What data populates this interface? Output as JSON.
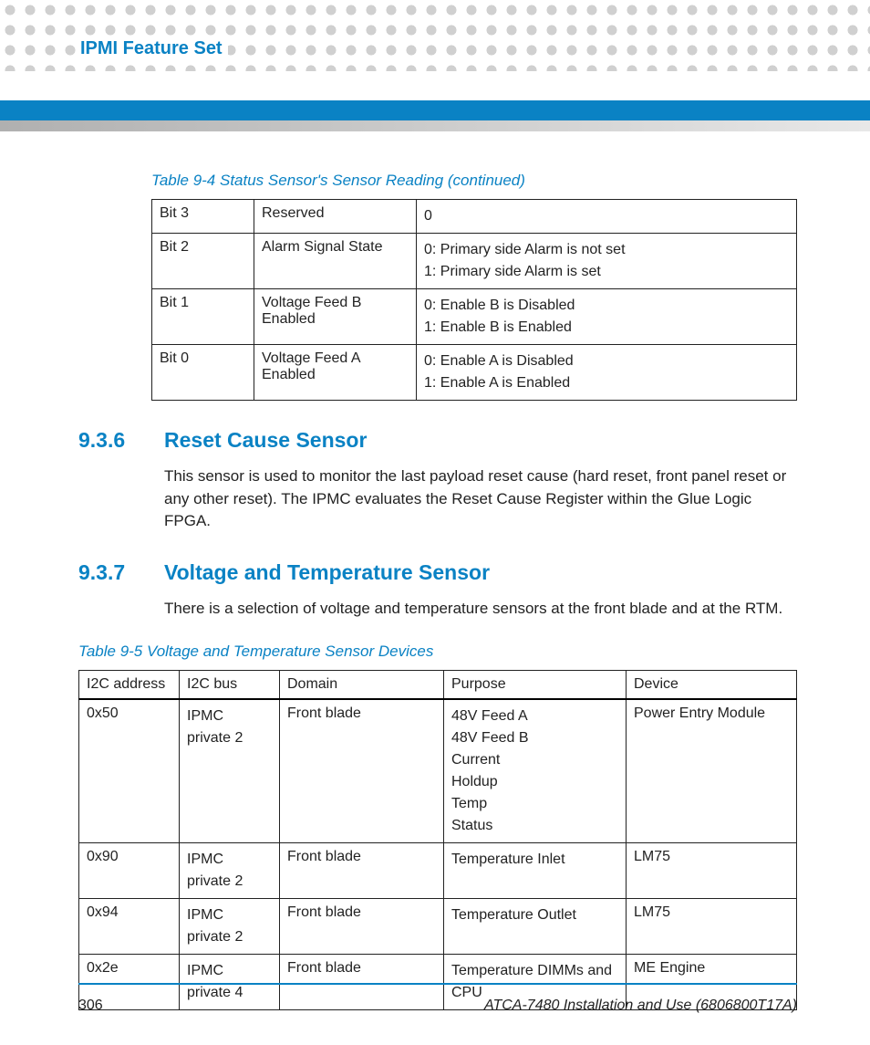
{
  "header": {
    "chapter_title": "IPMI Feature Set"
  },
  "table94": {
    "caption": "Table 9-4 Status Sensor's Sensor Reading (continued)",
    "rows": [
      {
        "bit": "Bit 3",
        "name": "Reserved",
        "desc_lines": [
          "0"
        ]
      },
      {
        "bit": "Bit 2",
        "name": "Alarm Signal State",
        "desc_lines": [
          "0: Primary side Alarm is not set",
          "1: Primary side Alarm is set"
        ]
      },
      {
        "bit": "Bit 1",
        "name": "Voltage Feed B Enabled",
        "desc_lines": [
          "0: Enable B is Disabled",
          "1: Enable B is Enabled"
        ]
      },
      {
        "bit": "Bit 0",
        "name": "Voltage Feed A Enabled",
        "desc_lines": [
          "0: Enable A is Disabled",
          "1: Enable A is Enabled"
        ]
      }
    ]
  },
  "section936": {
    "num": "9.3.6",
    "title": "Reset Cause Sensor",
    "body": "This sensor is used to monitor the last payload reset cause (hard reset, front panel reset or any other reset). The IPMC evaluates the Reset Cause Register within the Glue Logic FPGA."
  },
  "section937": {
    "num": "9.3.7",
    "title": "Voltage and Temperature Sensor",
    "body": "There is a selection of voltage and temperature sensors at the front blade and at the RTM."
  },
  "table95": {
    "caption": "Table 9-5 Voltage and Temperature Sensor Devices",
    "headers": [
      "I2C address",
      "I2C bus",
      "Domain",
      "Purpose",
      "Device"
    ],
    "rows": [
      {
        "addr": "0x50",
        "bus_lines": [
          "IPMC",
          "private 2"
        ],
        "domain": "Front blade",
        "purpose_lines": [
          "48V Feed A",
          "48V Feed B",
          "Current",
          "Holdup",
          "Temp",
          "Status"
        ],
        "device": "Power Entry Module"
      },
      {
        "addr": "0x90",
        "bus_lines": [
          "IPMC",
          "private 2"
        ],
        "domain": "Front blade",
        "purpose_lines": [
          "Temperature Inlet"
        ],
        "device": "LM75"
      },
      {
        "addr": "0x94",
        "bus_lines": [
          "IPMC",
          "private 2"
        ],
        "domain": "Front blade",
        "purpose_lines": [
          "Temperature Outlet"
        ],
        "device": "LM75"
      },
      {
        "addr": "0x2e",
        "bus_lines": [
          "IPMC",
          "private 4"
        ],
        "domain": "Front blade",
        "purpose_lines": [
          "Temperature DIMMs and CPU"
        ],
        "device": "ME Engine"
      }
    ]
  },
  "footer": {
    "page_number": "306",
    "doc_title": "ATCA-7480 Installation and Use (6806800T17A)"
  }
}
